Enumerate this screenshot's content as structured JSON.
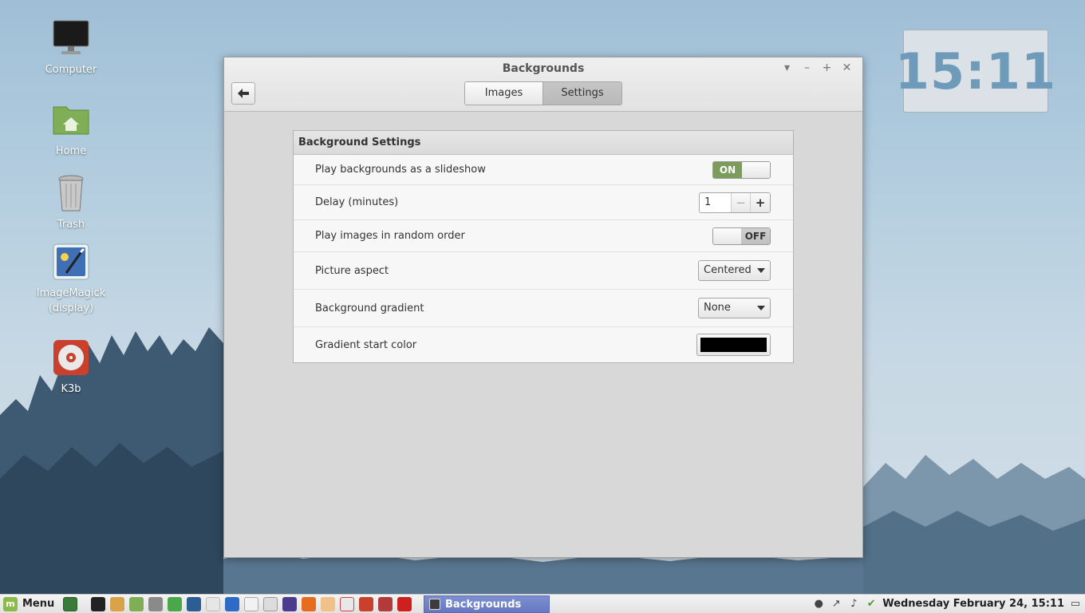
{
  "desktop": {
    "icons": [
      {
        "label": "Computer"
      },
      {
        "label": "Home"
      },
      {
        "label": "Trash"
      },
      {
        "label": "ImageMagick (display)"
      },
      {
        "label": "K3b"
      }
    ],
    "clock_desklet": "15:11"
  },
  "window": {
    "title": "Backgrounds",
    "tabs": [
      {
        "label": "Images",
        "selected": false
      },
      {
        "label": "Settings",
        "selected": true
      }
    ],
    "panel": {
      "heading": "Background Settings",
      "rows": [
        {
          "label": "Play backgrounds as a slideshow",
          "control": "switch",
          "value": "ON"
        },
        {
          "label": "Delay (minutes)",
          "control": "spin",
          "value": "1"
        },
        {
          "label": "Play images in random order",
          "control": "switch",
          "value": "OFF"
        },
        {
          "label": "Picture aspect",
          "control": "combo",
          "value": "Centered"
        },
        {
          "label": "Background gradient",
          "control": "combo",
          "value": "None"
        },
        {
          "label": "Gradient start color",
          "control": "color",
          "value": "#000000"
        }
      ]
    }
  },
  "taskbar": {
    "menu_label": "Menu",
    "task_label": "Backgrounds",
    "datetime": "Wednesday February 24, 15:11"
  },
  "colors": {
    "switch_on": "#7c9c5c",
    "task_active": "#6678c2",
    "clock_text": "#6f9bbb"
  }
}
